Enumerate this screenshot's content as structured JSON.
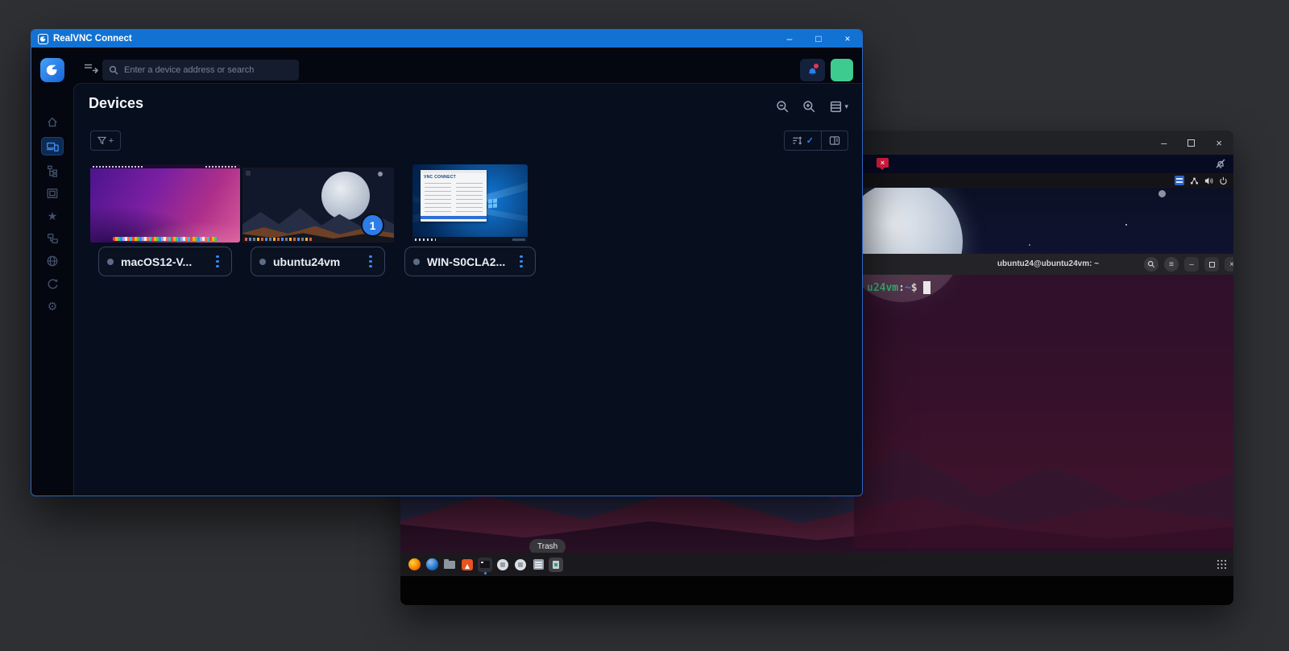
{
  "window": {
    "title": "RealVNC Connect"
  },
  "glyphs": {
    "minimize": "–",
    "maximize": "□",
    "close": "×",
    "check": "✓",
    "plus": "+",
    "caret": "▾",
    "gear": "⚙",
    "star": "★",
    "menu": "≡"
  },
  "header": {
    "search_placeholder": "Enter a device address or search",
    "icons": [
      "collapse-sidebar",
      "search",
      "notifications-bell",
      "account-avatar"
    ]
  },
  "sidebar": {
    "active_item": "devices",
    "items": [
      {
        "icon": "home-icon"
      },
      {
        "icon": "devices-icon"
      },
      {
        "icon": "hierarchy-icon"
      },
      {
        "icon": "screens-icon"
      },
      {
        "icon": "favorites-star-icon"
      },
      {
        "icon": "deployment-icon"
      },
      {
        "icon": "web-icon"
      },
      {
        "icon": "sync-icon"
      },
      {
        "icon": "settings-gear-icon"
      }
    ]
  },
  "page": {
    "title": "Devices",
    "toolbar_icons": [
      "zoom-out",
      "zoom-in",
      "table-view"
    ],
    "filter_icon": "filter-add",
    "segment_icons": [
      "sort-check",
      "card-view"
    ]
  },
  "devices": [
    {
      "name": "macOS12-V...",
      "os": "macos"
    },
    {
      "name": "ubuntu24vm",
      "os": "ubuntu",
      "badge": "1"
    },
    {
      "name": "WIN-S0CLA2...",
      "os": "windows",
      "thumb_title": "VNC CONNECT"
    }
  ],
  "colors": {
    "titlebar_blue": "#1272d4",
    "accent_blue": "#2f7fe8",
    "avatar_green": "#3ecb8f",
    "alert_red": "#e11d3f",
    "badge_blue": "#2e7ce6"
  },
  "viewer": {
    "toolbar_icons": [
      "disconnect-alert",
      "notifications-muted"
    ],
    "tray_icons": [
      "keyboard-layout",
      "network",
      "volume",
      "power"
    ],
    "remote": {
      "terminal": {
        "title": "ubuntu24@ubuntu24vm: ~",
        "prompt_host": "u24vm",
        "prompt_colon": ":",
        "prompt_path": "~",
        "prompt_symbol": "$",
        "header_icons": [
          "search",
          "menu",
          "minimize",
          "maximize",
          "close"
        ]
      },
      "dock_icons": [
        "firefox",
        "thunderbird",
        "files",
        "software-store",
        "terminal",
        "circle-app-1",
        "circle-app-2",
        "software",
        "trash",
        "show-apps"
      ],
      "dock_tooltip": "Trash"
    }
  }
}
